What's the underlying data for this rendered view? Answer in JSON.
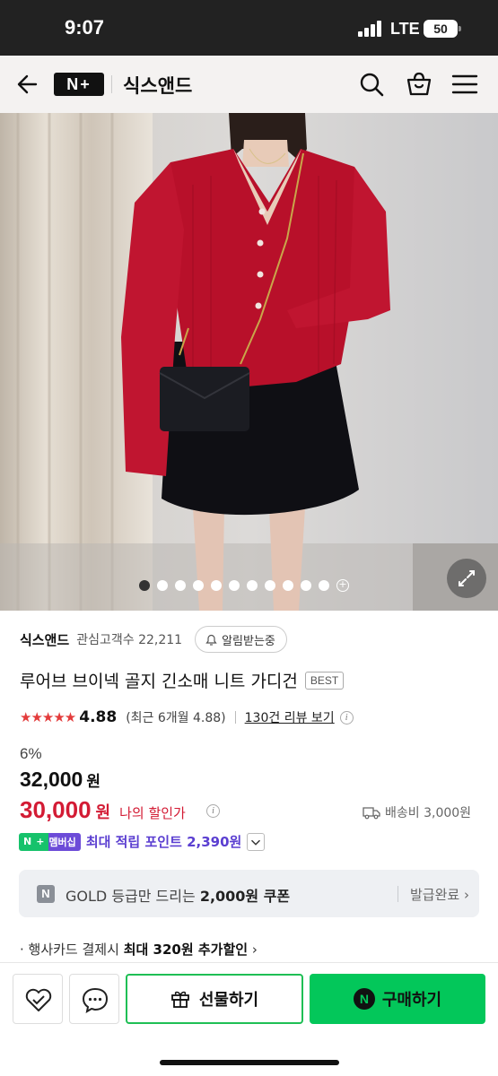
{
  "status_bar": {
    "time": "9:07",
    "network": "LTE",
    "battery": "50"
  },
  "header": {
    "logo": "N+",
    "store_name": "식스앤드"
  },
  "gallery": {
    "total_dots": 11,
    "active_index": 0
  },
  "seller": {
    "name": "식스앤드",
    "interest_label": "관심고객수",
    "interest_count": "22,211",
    "notify_label": "알림받는중"
  },
  "product": {
    "title": "루어브 브이넥 골지 긴소매 니트 가디건",
    "badge": "BEST"
  },
  "rating": {
    "stars": "★★★★★",
    "score": "4.88",
    "recent": "(최근 6개월 4.88)",
    "review_link": "130건 리뷰 보기"
  },
  "price": {
    "discount_rate": "6%",
    "original": "32,000",
    "currency": "원",
    "sale": "30,000",
    "my_discount_label": "나의 할인가",
    "shipping": "배송비 3,000원"
  },
  "points": {
    "badge_n": "N",
    "badge_plus": "+",
    "badge_label": "멤버십",
    "text": "최대 적립 포인트 2,390원"
  },
  "coupon": {
    "icon": "N",
    "text_prefix": "GOLD 등급만 드리는 ",
    "text_bold": "2,000원 쿠폰",
    "status": "발급완료 ›"
  },
  "card_discount": {
    "prefix": "· 행사카드 결제시 ",
    "bold": "최대 320원 추가할인",
    "suffix": " ›"
  },
  "actions": {
    "gift_label": "선물하기",
    "buy_label": "구매하기",
    "buy_icon": "N"
  },
  "colors": {
    "accent_red": "#d31b34",
    "naver_green": "#03c75a",
    "membership_purple": "#5b3fd1"
  }
}
